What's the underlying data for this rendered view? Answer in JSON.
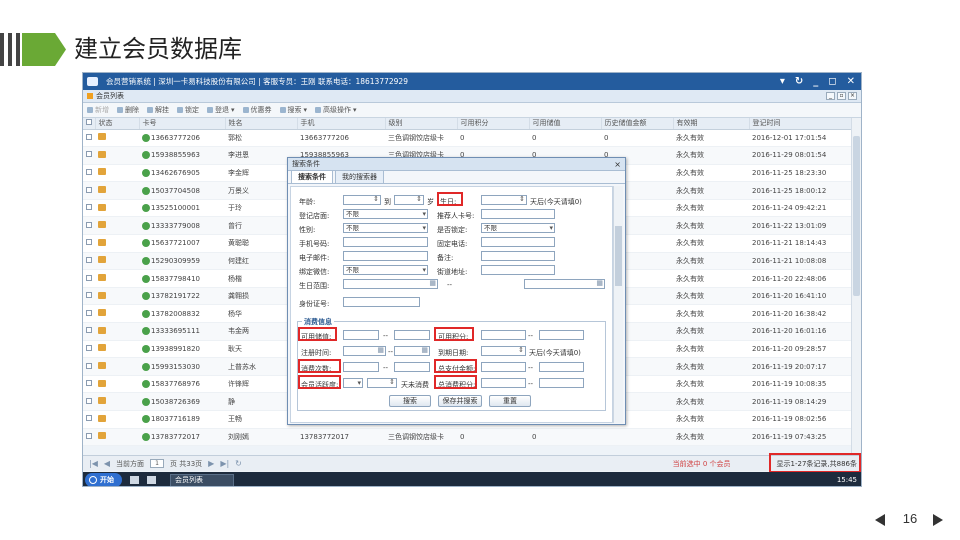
{
  "slide": {
    "title": "建立会员数据库",
    "page_number": "16",
    "accent": "#6aa935"
  },
  "app": {
    "title": "会员营销系统 | 深圳一卡易科技股份有限公司 | 客服专员：王刚 联系电话：18613772929",
    "tab_label": "会员列表",
    "toolbar": {
      "add": "新增",
      "delete": "删除",
      "unlock": "解挂",
      "lock": "锁定",
      "ops": "登退",
      "coupon": "优惠券",
      "search": "搜索",
      "advanced": "高级操作"
    },
    "columns": [
      "状态",
      "卡号",
      "姓名",
      "手机",
      "级别",
      "可用积分",
      "可用储值",
      "历史储值金额",
      "有效期",
      "登记时间"
    ],
    "rows": [
      {
        "card": "13663777206",
        "name": "郭松",
        "phone": "13663777206",
        "level": "三色调钢饺店级卡",
        "points": "0",
        "stored": "0",
        "history": "0",
        "validity": "永久有效",
        "reg": "2016-12-01 17:01:54"
      },
      {
        "card": "15938855963",
        "name": "李进恩",
        "phone": "15938855963",
        "level": "三色调钢饺店级卡",
        "points": "0",
        "stored": "0",
        "history": "0",
        "validity": "永久有效",
        "reg": "2016-11-29 08:01:54"
      },
      {
        "card": "13462676905",
        "name": "李金辉",
        "phone": "",
        "level": "",
        "points": "",
        "stored": "",
        "history": "",
        "validity": "永久有效",
        "reg": "2016-11-25 18:23:30"
      },
      {
        "card": "15037704508",
        "name": "万景义",
        "phone": "",
        "level": "",
        "points": "",
        "stored": "",
        "history": "",
        "validity": "永久有效",
        "reg": "2016-11-25 18:00:12"
      },
      {
        "card": "13525100001",
        "name": "于玲",
        "phone": "",
        "level": "",
        "points": "",
        "stored": "",
        "history": "",
        "validity": "永久有效",
        "reg": "2016-11-24 09:42:21"
      },
      {
        "card": "13333779008",
        "name": "曾行",
        "phone": "",
        "level": "",
        "points": "",
        "stored": "",
        "history": "",
        "validity": "永久有效",
        "reg": "2016-11-22 13:01:09"
      },
      {
        "card": "15637721007",
        "name": "黄聪聪",
        "phone": "",
        "level": "",
        "points": "",
        "stored": "",
        "history": "",
        "validity": "永久有效",
        "reg": "2016-11-21 18:14:43"
      },
      {
        "card": "15290309959",
        "name": "何建红",
        "phone": "",
        "level": "",
        "points": "",
        "stored": "",
        "history": "",
        "validity": "永久有效",
        "reg": "2016-11-21 10:08:08"
      },
      {
        "card": "15837798410",
        "name": "杨楷",
        "phone": "",
        "level": "",
        "points": "",
        "stored": "",
        "history": "",
        "validity": "永久有效",
        "reg": "2016-11-20 22:48:06"
      },
      {
        "card": "13782191722",
        "name": "龚翱损",
        "phone": "",
        "level": "",
        "points": "",
        "stored": "",
        "history": "",
        "validity": "永久有效",
        "reg": "2016-11-20 16:41:10"
      },
      {
        "card": "13782008832",
        "name": "杨华",
        "phone": "",
        "level": "",
        "points": "",
        "stored": "",
        "history": "",
        "validity": "永久有效",
        "reg": "2016-11-20 16:38:42"
      },
      {
        "card": "13333695111",
        "name": "韦金两",
        "phone": "",
        "level": "",
        "points": "",
        "stored": "",
        "history": "",
        "validity": "永久有效",
        "reg": "2016-11-20 16:01:16"
      },
      {
        "card": "13938991820",
        "name": "耿天",
        "phone": "",
        "level": "",
        "points": "",
        "stored": "",
        "history": "",
        "validity": "永久有效",
        "reg": "2016-11-20 09:28:57"
      },
      {
        "card": "15993153030",
        "name": "上普苏水",
        "phone": "",
        "level": "",
        "points": "",
        "stored": "",
        "history": "",
        "validity": "永久有效",
        "reg": "2016-11-19 20:07:17"
      },
      {
        "card": "15837768976",
        "name": "许锋辉",
        "phone": "",
        "level": "",
        "points": "",
        "stored": "",
        "history": "",
        "validity": "永久有效",
        "reg": "2016-11-19 10:08:35"
      },
      {
        "card": "15038726369",
        "name": "静",
        "phone": "",
        "level": "",
        "points": "",
        "stored": "",
        "history": "",
        "validity": "永久有效",
        "reg": "2016-11-19 08:14:29"
      },
      {
        "card": "18037716189",
        "name": "王畅",
        "phone": "",
        "level": "",
        "points": "",
        "stored": "",
        "history": "",
        "validity": "永久有效",
        "reg": "2016-11-19 08:02:56"
      },
      {
        "card": "13783772017",
        "name": "刘刚嫣",
        "phone": "13783772017",
        "level": "三色调钢饺店级卡",
        "points": "0",
        "stored": "0",
        "history": "",
        "validity": "永久有效",
        "reg": "2016-11-19 07:43:25"
      }
    ],
    "pager": {
      "current_label": "当前方面",
      "page_value": "1",
      "total": "页 共33页",
      "selected_info": "当前选中 0 个会员",
      "record_info": "显示1-27条记录,共886条"
    },
    "taskbar": {
      "start": "开始",
      "task": "会员列表",
      "clock": "15:45"
    }
  },
  "dialog": {
    "title": "搜索条件",
    "tabs": [
      "搜索条件",
      "我的搜索器"
    ],
    "labels": {
      "age": "年龄:",
      "to": "到",
      "age_unit": "岁",
      "birthday": "生日:",
      "days_later": "天后(今天请填0)",
      "reg_store": "登记店面:",
      "referrer": "推荐人卡号:",
      "gender": "性别:",
      "locked": "是否锁定:",
      "mobile": "手机号码:",
      "phone": "固定电话:",
      "email": "电子邮件:",
      "remark": "备注:",
      "wechat": "绑定微信:",
      "address": "街道地址:",
      "birth_range": "生日范围:",
      "id_card": "身份证号:",
      "consume_legend": "消费信息",
      "stored_value": "可用储值:",
      "points": "可用积分:",
      "reg_time": "注册时间:",
      "expire": "到期日期:",
      "consume_times": "消费次数:",
      "total_pay": "总支付金额:",
      "activity": "会员活跃度:",
      "no_consume": "天未消费",
      "total_points": "总消费积分:"
    },
    "select_default": "不限",
    "buttons": {
      "search": "搜索",
      "save_search": "保存并搜索",
      "reset": "重置"
    }
  }
}
